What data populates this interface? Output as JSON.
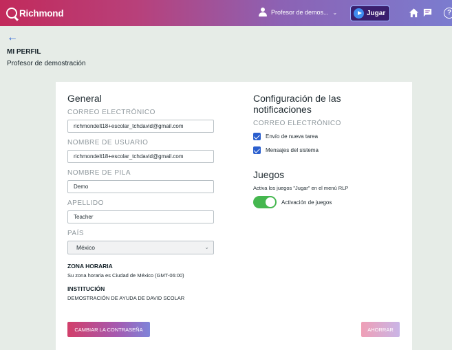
{
  "header": {
    "logo_text": "Richmond",
    "user_name": "Profesor de demos...",
    "play_label": "Jugar",
    "help_label": "?"
  },
  "page": {
    "back_label": "←",
    "title": "MI PERFIL",
    "subtitle": "Profesor de demostración"
  },
  "general": {
    "title": "General",
    "email_label": "CORREO ELECTRÓNICO",
    "email_value": "richmondelt18+escolar_tchdavid@gmail.com",
    "username_label": "NOMBRE DE USUARIO",
    "username_value": "richmondelt18+escolar_tchdavid@gmail.com",
    "firstname_label": "NOMBRE DE PILA",
    "firstname_value": "Demo",
    "lastname_label": "APELLIDO",
    "lastname_value": "Teacher",
    "country_label": "PAÍS",
    "country_value": "México",
    "timezone_label": "ZONA HORARIA",
    "timezone_text": "Su zona horaria es Ciudad de México (GMT-06:00)",
    "institution_label": "INSTITUCIÓN",
    "institution_text": "DEMOSTRACIÓN DE AYUDA DE DAVID SCOLAR"
  },
  "notifications": {
    "title": "Configuración de las notificaciones",
    "email_label": "CORREO ELECTRÓNICO",
    "options": [
      {
        "label": "Envío de nueva tarea",
        "checked": true
      },
      {
        "label": "Mensajes del sistema",
        "checked": true
      }
    ]
  },
  "games": {
    "title": "Juegos",
    "description": "Activa los juegos \"Jugar\" en el menú RLP",
    "toggle_label": "Activación de juegos",
    "toggle_on": true
  },
  "actions": {
    "change_password": "CAMBIAR LA CONTRASEÑA",
    "save": "AHORRAR"
  },
  "colors": {
    "accent_blue": "#2b5fce",
    "toggle_green": "#45b74f",
    "header_gradient_start": "#c22a5b",
    "header_gradient_end": "#7b7ccf"
  }
}
